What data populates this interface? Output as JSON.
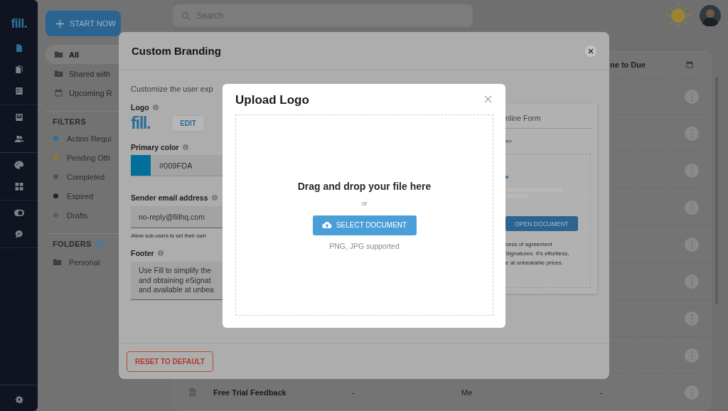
{
  "rail": {
    "logo": "fill.",
    "groups": [
      {
        "items": [
          {
            "kind": "document",
            "selected": true
          },
          {
            "kind": "documents",
            "selected": false
          },
          {
            "kind": "form",
            "selected": false
          }
        ]
      },
      {
        "items": [
          {
            "kind": "inbox",
            "selected": false
          },
          {
            "kind": "users",
            "selected": false
          }
        ]
      },
      {
        "items": [
          {
            "kind": "palette",
            "selected": false
          },
          {
            "kind": "puzzle",
            "selected": false
          }
        ]
      },
      {
        "items": [
          {
            "kind": "toggle",
            "selected": false
          },
          {
            "kind": "chat",
            "selected": false
          }
        ]
      }
    ]
  },
  "nav": {
    "start_button": "START NOW",
    "views": [
      {
        "label": "All",
        "kind": "folder",
        "selected": true
      },
      {
        "label": "Shared with",
        "kind": "shared",
        "selected": false
      },
      {
        "label": "Upcoming R",
        "kind": "calendar",
        "selected": false
      }
    ],
    "filters": {
      "heading": "FILTERS",
      "items": [
        {
          "label": "Action Requi",
          "color": "#2e6f9e"
        },
        {
          "label": "Pending Oth",
          "color": "#8a7a35"
        },
        {
          "label": "Completed",
          "color": "#4d5652"
        },
        {
          "label": "Expired",
          "color": "#22252e"
        },
        {
          "label": "Drafts",
          "color": "#5d5d5d"
        }
      ]
    },
    "folders": {
      "heading": "FOLDERS",
      "items": [
        {
          "label": "Personal"
        }
      ]
    }
  },
  "search": {
    "placeholder": "Search"
  },
  "table": {
    "header": "ne to Due",
    "rows": [
      {
        "kind": "covered"
      },
      {
        "kind": "covered"
      },
      {
        "kind": "covered"
      },
      {
        "kind": "covered"
      },
      {
        "kind": "covered"
      },
      {
        "kind": "covered"
      },
      {
        "kind": "covered"
      },
      {
        "kind": "covered"
      },
      {
        "kind": "file",
        "name": "Free Trial Feedback",
        "column_2": "-",
        "column_3": "Me",
        "column_4": "-"
      }
    ]
  },
  "branding": {
    "title": "Custom Branding",
    "intro": "Customize the user exp",
    "logo_label": "Logo",
    "logo": "fill.",
    "edit_button": "EDIT",
    "color_label": "Primary color",
    "color_value": "#009FDA",
    "email_label": "Sender email address",
    "email_value": "no-reply@fillhq.com",
    "email_note": "Allow sub-users to set their own",
    "footer_label": "Footer",
    "footer_lines": [
      "Use Fill to simplify the",
      "and obtaining eSignat",
      "and available at unbea"
    ],
    "preview": {
      "title": "nline Form",
      "line": "n>",
      "button": "OPEN DOCUMENT",
      "text_lines": [
        "cess of agreement",
        "Signatures. It's effortless,",
        "e at unbeatable prices."
      ]
    },
    "reset_button": "RESET TO DEFAULT"
  },
  "upload": {
    "title": "Upload Logo",
    "drop_text": "Drag and drop your file here",
    "or": "or",
    "button": "SELECT DOCUMENT",
    "hint": "PNG, JPG supported"
  }
}
